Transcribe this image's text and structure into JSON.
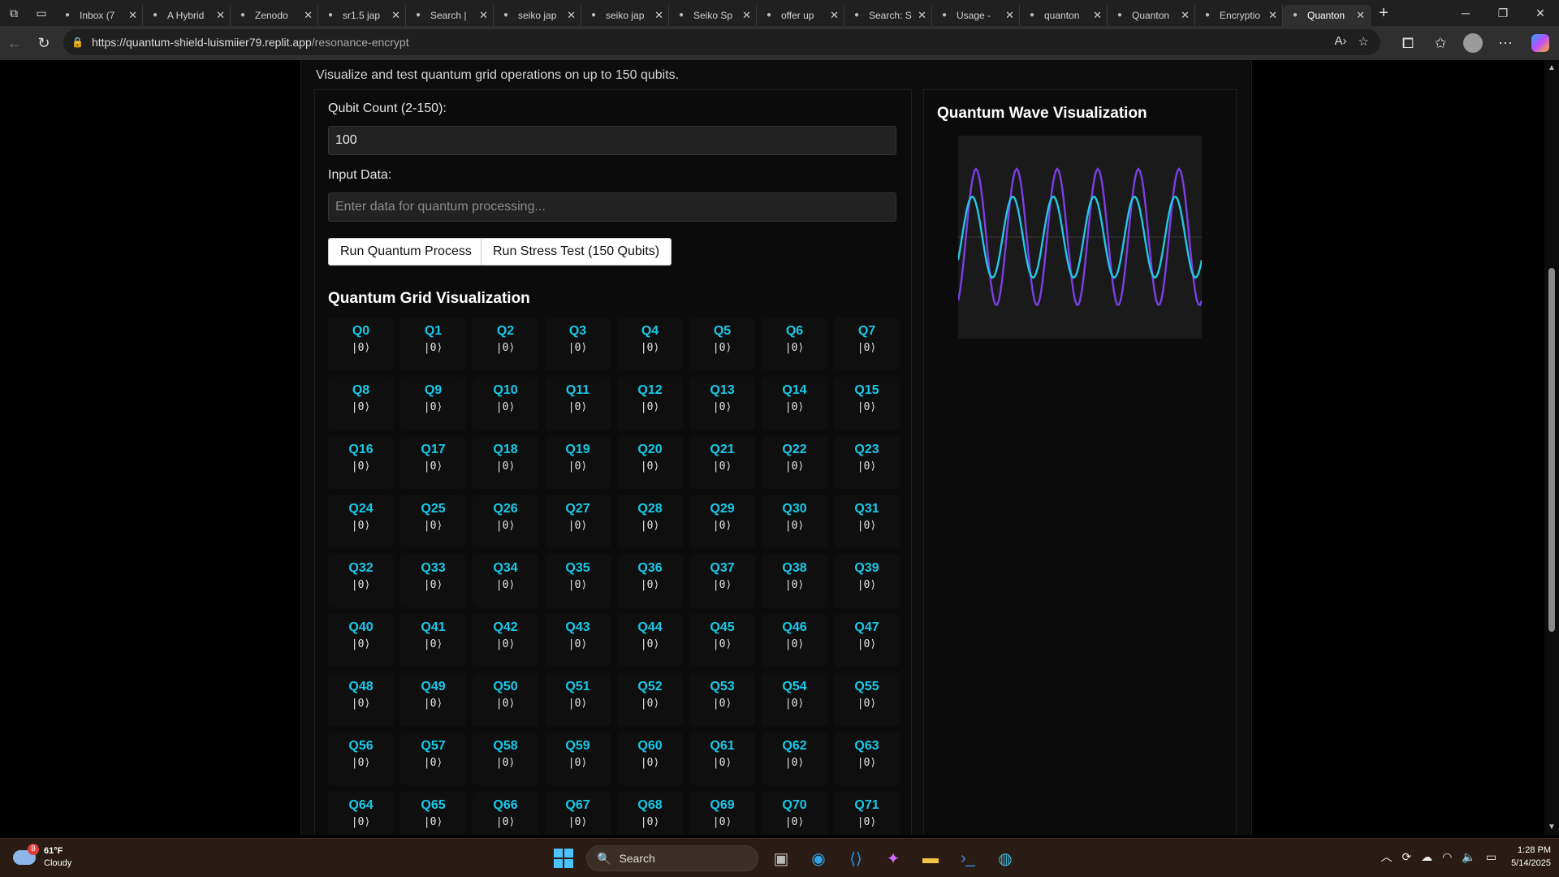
{
  "browser": {
    "tabs": [
      {
        "title": "Inbox (7",
        "icon": "gmail-icon",
        "active": false
      },
      {
        "title": "A Hybrid",
        "icon": "doc-icon",
        "active": false
      },
      {
        "title": "Zenodo",
        "icon": "zenodo-icon",
        "active": false
      },
      {
        "title": "sr1.5 jap",
        "icon": "search-icon",
        "active": false
      },
      {
        "title": "Search |",
        "icon": "globe-icon",
        "active": false
      },
      {
        "title": "seiko jap",
        "icon": "search-icon",
        "active": false
      },
      {
        "title": "seiko jap",
        "icon": "search-icon",
        "active": false
      },
      {
        "title": "Seiko Sp",
        "icon": "loading-icon",
        "active": false
      },
      {
        "title": "offer up",
        "icon": "search-icon",
        "active": false
      },
      {
        "title": "Search: S",
        "icon": "openai-icon",
        "active": false
      },
      {
        "title": "Usage -",
        "icon": "replit-icon",
        "active": false
      },
      {
        "title": "quanton",
        "icon": "replit-icon",
        "active": false
      },
      {
        "title": "Quanton",
        "icon": "globe-icon",
        "active": false
      },
      {
        "title": "Encryptio",
        "icon": "app-icon",
        "active": false
      },
      {
        "title": "Quanton",
        "icon": "globe-icon",
        "active": true
      }
    ],
    "url_host": "https://quantum-shield-luismiier79.replit.app",
    "url_path": "/resonance-encrypt"
  },
  "page": {
    "subtitle": "Visualize and test quantum grid operations on up to 150 qubits.",
    "qubit_count_label": "Qubit Count (2-150):",
    "qubit_count_value": "100",
    "input_data_label": "Input Data:",
    "input_data_placeholder": "Enter data for quantum processing...",
    "run_button": "Run Quantum Process",
    "stress_button": "Run Stress Test (150 Qubits)",
    "grid_title": "Quantum Grid Visualization",
    "wave_title": "Quantum Wave Visualization",
    "qubit_state": "|0⟩",
    "qubits": [
      "Q0",
      "Q1",
      "Q2",
      "Q3",
      "Q4",
      "Q5",
      "Q6",
      "Q7",
      "Q8",
      "Q9",
      "Q10",
      "Q11",
      "Q12",
      "Q13",
      "Q14",
      "Q15",
      "Q16",
      "Q17",
      "Q18",
      "Q19",
      "Q20",
      "Q21",
      "Q22",
      "Q23",
      "Q24",
      "Q25",
      "Q26",
      "Q27",
      "Q28",
      "Q29",
      "Q30",
      "Q31",
      "Q32",
      "Q33",
      "Q34",
      "Q35",
      "Q36",
      "Q37",
      "Q38",
      "Q39",
      "Q40",
      "Q41",
      "Q42",
      "Q43",
      "Q44",
      "Q45",
      "Q46",
      "Q47",
      "Q48",
      "Q49",
      "Q50",
      "Q51",
      "Q52",
      "Q53",
      "Q54",
      "Q55",
      "Q56",
      "Q57",
      "Q58",
      "Q59",
      "Q60",
      "Q61",
      "Q62",
      "Q63",
      "Q64",
      "Q65",
      "Q66",
      "Q67",
      "Q68",
      "Q69",
      "Q70",
      "Q71"
    ],
    "wave_colors": {
      "primary": "#7b3fe4",
      "secondary": "#22c8e6"
    }
  },
  "taskbar": {
    "weather_temp": "61°F",
    "weather_desc": "Cloudy",
    "weather_badge": "8",
    "search_placeholder": "Search",
    "time": "1:28 PM",
    "date": "5/14/2025"
  }
}
